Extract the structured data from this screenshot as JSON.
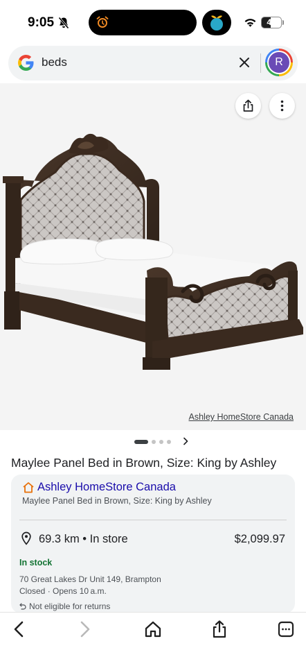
{
  "status_bar": {
    "time": "9:05",
    "battery_level": "46",
    "battery_fraction": 0.46,
    "icons": [
      "bell-off-icon",
      "alarm-icon",
      "app-icon",
      "wifi-icon",
      "battery-icon"
    ]
  },
  "search": {
    "query": "beds",
    "avatar_letter": "R",
    "icons": [
      "google-logo",
      "clear-icon"
    ]
  },
  "image": {
    "source": "Ashley HomeStore Canada",
    "icons": [
      "share-icon",
      "more-vert-icon"
    ],
    "page_count": 4,
    "current_page": 1
  },
  "product": {
    "title": "Maylee Panel Bed in Brown, Size: King by Ashley"
  },
  "offer": {
    "store_name": "Ashley HomeStore Canada",
    "subtitle": "Maylee Panel Bed in Brown, Size: King by Ashley",
    "distance": "69.3 km • In store",
    "price": "$2,099.97",
    "stock": "In stock",
    "address": "70 Great Lakes Dr Unit 149, Brampton",
    "hours": "Closed · Opens 10 a.m.",
    "returns": "Not eligible for returns"
  },
  "toolbar": {
    "icons": [
      "back-icon",
      "forward-icon",
      "home-icon",
      "share-icon",
      "tabs-icon"
    ]
  },
  "colors": {
    "link": "#1a0dab",
    "stock_green": "#137333",
    "store_icon": "#e8710a",
    "avatar": "#6a4bb6"
  }
}
